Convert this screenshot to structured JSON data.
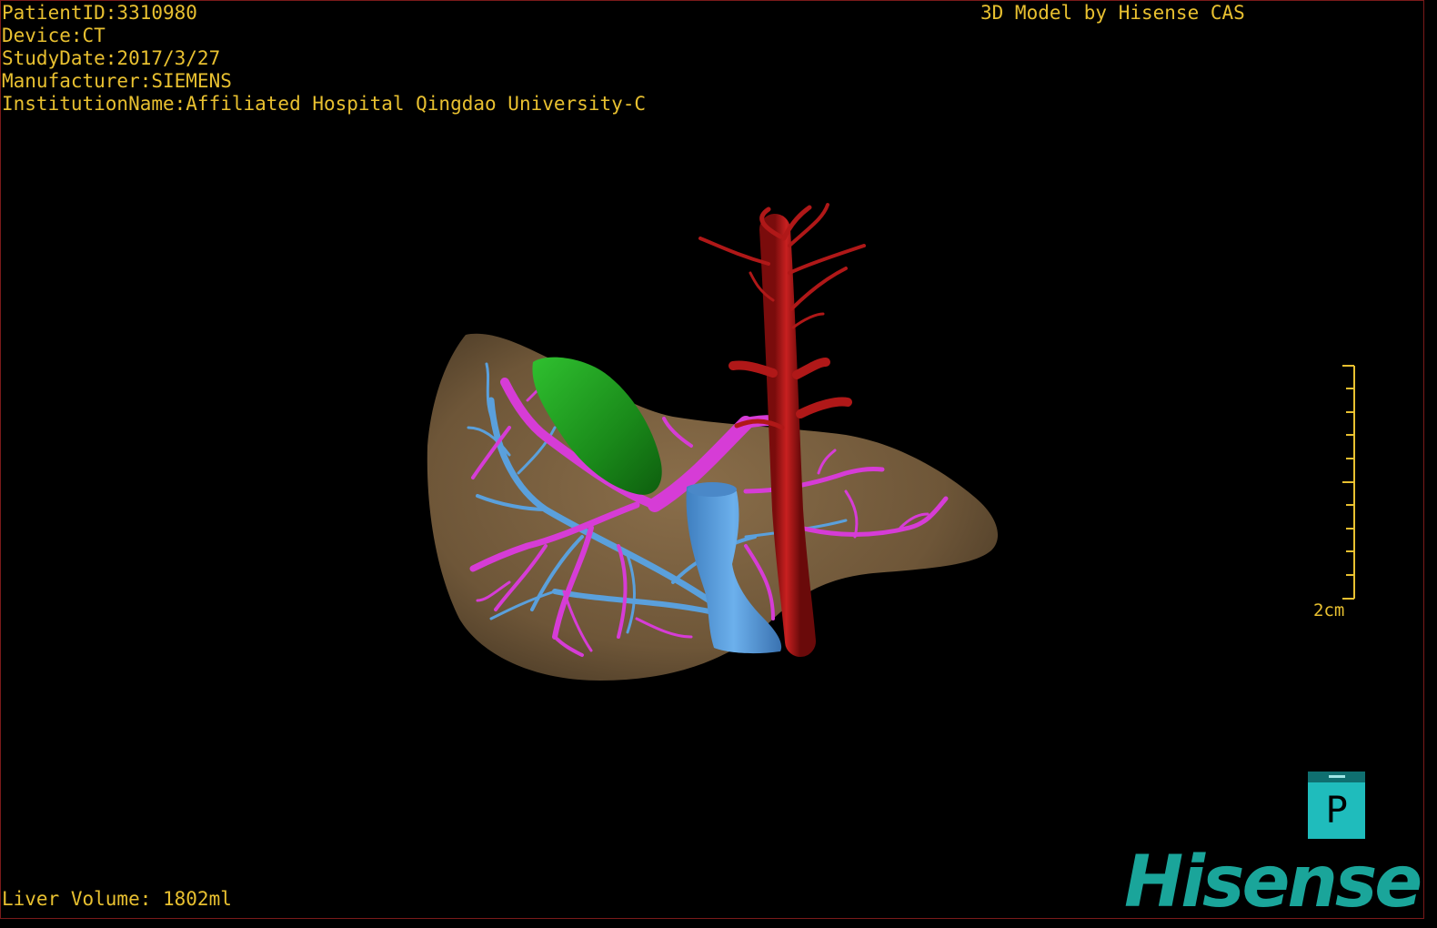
{
  "header": {
    "patient_id": "PatientID:3310980",
    "device": "Device:CT",
    "study_date": "StudyDate:2017/3/27",
    "manufacturer": "Manufacturer:SIEMENS",
    "institution": "InstitutionName:Affiliated Hospital Qingdao University-C"
  },
  "model_credit": "3D Model by Hisense CAS",
  "liver_volume": "Liver Volume: 1802ml",
  "scale_bar": {
    "label": "2cm"
  },
  "view_button": {
    "label": "P"
  },
  "logo": {
    "text": "Hisense"
  },
  "colors": {
    "text": "#e8c030",
    "liver": "#7a6142",
    "gallbladder": "#1f9a1f",
    "artery": "#b01818",
    "portal_vein": "#d63cd6",
    "hepatic_vein": "#5aa0dc",
    "logo": "#1aa59a",
    "button": "#1fbcbc"
  },
  "icons": [
    "p-view-icon",
    "hisense-logo"
  ]
}
